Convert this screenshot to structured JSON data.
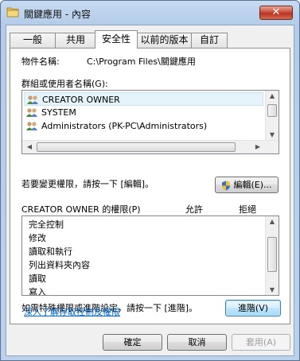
{
  "window": {
    "title": "關鍵應用 - 內容"
  },
  "tabs": [
    {
      "label": "一般"
    },
    {
      "label": "共用"
    },
    {
      "label": "安全性"
    },
    {
      "label": "以前的版本"
    },
    {
      "label": "自訂"
    }
  ],
  "security": {
    "object_label": "物件名稱:",
    "object_value": "C:\\Program Files\\關鍵應用",
    "groups_label": "群組或使用者名稱(G):",
    "groups": [
      {
        "name": "CREATOR OWNER",
        "icon": "users-icon"
      },
      {
        "name": "SYSTEM",
        "icon": "users-icon"
      },
      {
        "name": "Administrators (PK-PC\\Administrators)",
        "icon": "users-icon"
      }
    ],
    "change_hint": "若要變更權限，請按一下 [編輯]。",
    "edit_button": "編輯(E)...",
    "perm_header": "CREATOR OWNER 的權限(P)",
    "allow_header": "允許",
    "deny_header": "拒絕",
    "permissions": [
      "完全控制",
      "修改",
      "讀取和執行",
      "列出資料夾內容",
      "讀取",
      "寫入"
    ],
    "advanced_hint": "如需特殊權限或進階設定，請按一下 [進階]。",
    "advanced_button": "進階(V)",
    "learn_link": "深入了解存取控制及權限"
  },
  "footer": {
    "ok": "確定",
    "cancel": "取消",
    "apply": "套用(A)"
  }
}
